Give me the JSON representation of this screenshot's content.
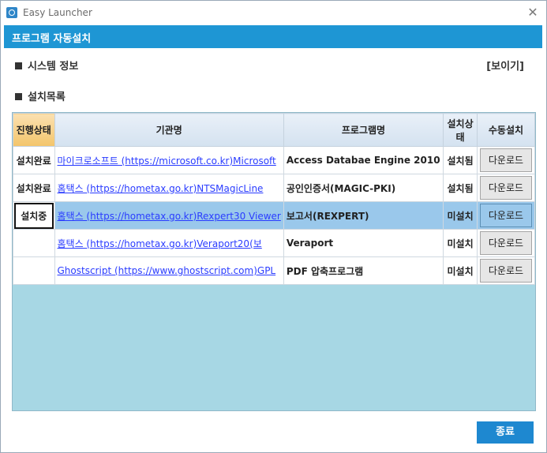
{
  "window": {
    "title": "Easy Launcher",
    "close_glyph": "✕"
  },
  "header": {
    "title": "프로그램 자동설치"
  },
  "system_section": {
    "label": "시스템 정보",
    "show_label": "[보이기]"
  },
  "list_section": {
    "label": "설치목록"
  },
  "table": {
    "columns": [
      "진행상태",
      "기관명",
      "프로그램명",
      "설치상태",
      "수동설치"
    ],
    "rows": [
      {
        "progress": "설치완료",
        "org": "마이크로소프트 (https://microsoft.co.kr)Microsoft",
        "program": "Access Databae Engine 2010",
        "status": "설치됨",
        "action": "다운로드"
      },
      {
        "progress": "설치완료",
        "org": "홈택스 (https://hometax.go.kr)NTSMagicLine",
        "program": "공인인증서(MAGIC-PKI)",
        "status": "설치됨",
        "action": "다운로드"
      },
      {
        "progress": "설치중",
        "org": "홈택스 (https://hometax.go.kr)Rexpert30 Viewer",
        "program": "보고서(REXPERT)",
        "status": "미설치",
        "action": "다운로드"
      },
      {
        "progress": "",
        "org": "홈택스 (https://hometax.go.kr)Veraport20(보",
        "program": "Veraport",
        "status": "미설치",
        "action": "다운로드"
      },
      {
        "progress": "",
        "org": "Ghostscript (https://www.ghostscript.com)GPL",
        "program": "PDF 압축프로그램",
        "status": "미설치",
        "action": "다운로드"
      }
    ]
  },
  "footer": {
    "close_label": "종료"
  },
  "colors": {
    "accent": "#1e96d4",
    "grid_background": "#a7d7e4",
    "selected_row": "#9ac8eb"
  }
}
